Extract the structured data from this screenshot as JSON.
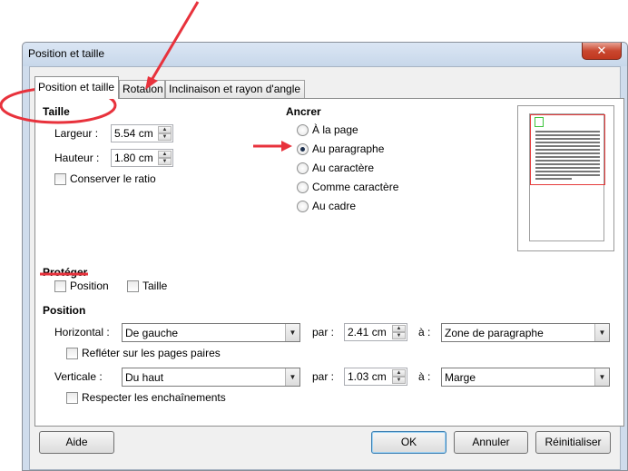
{
  "window": {
    "title": "Position et taille",
    "close_label": "✕"
  },
  "tabs": [
    "Position et taille",
    "Rotation",
    "Inclinaison et rayon d'angle"
  ],
  "size": {
    "header": "Taille",
    "width_label": "Largeur :",
    "width_value": "5.54 cm",
    "height_label": "Hauteur :",
    "height_value": "1.80 cm",
    "keep_ratio_label": "Conserver le ratio",
    "keep_ratio_checked": false
  },
  "anchor": {
    "header": "Ancrer",
    "options": [
      "À la page",
      "Au paragraphe",
      "Au caractère",
      "Comme caractère",
      "Au cadre"
    ],
    "selected": "Au paragraphe"
  },
  "protect": {
    "header": "Protéger",
    "position_label": "Position",
    "size_label": "Taille"
  },
  "position": {
    "header": "Position",
    "horizontal_label": "Horizontal :",
    "horizontal_value": "De gauche",
    "by_label": "par :",
    "horizontal_by": "2.41 cm",
    "to_label": "à :",
    "horizontal_to": "Zone de paragraphe",
    "mirror_label": "Refléter sur les pages paires",
    "vertical_label": "Verticale :",
    "vertical_value": "Du haut",
    "vertical_by": "1.03 cm",
    "vertical_to": "Marge",
    "follow_flow_label": "Respecter les enchaînements"
  },
  "buttons": {
    "help": "Aide",
    "ok": "OK",
    "cancel": "Annuler",
    "reset": "Réinitialiser"
  },
  "annotation_color": "#e8323c"
}
